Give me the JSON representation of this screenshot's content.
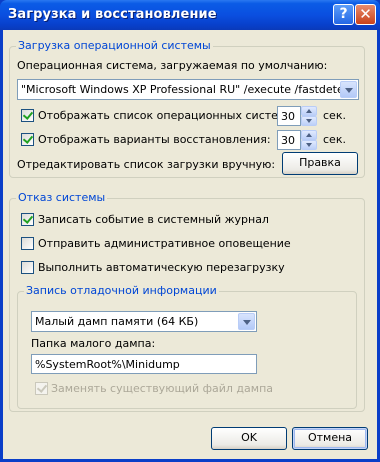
{
  "window": {
    "title": "Загрузка и восстановление",
    "help_icon": "?",
    "close_icon": "✕"
  },
  "boot": {
    "legend": "Загрузка операционной системы",
    "default_os_label": "Операционная система, загружаемая по умолчанию:",
    "default_os_value": "\"Microsoft Windows XP Professional RU\" /execute /fastdetect",
    "show_os_list_label": "Отображать список операционных систем:",
    "show_os_list_checked": true,
    "show_os_list_value": "30",
    "show_recovery_label": "Отображать варианты восстановления:",
    "show_recovery_checked": true,
    "show_recovery_value": "30",
    "seconds_unit": "сек.",
    "edit_label": "Отредактировать список загрузки вручную:",
    "edit_button": "Правка"
  },
  "failure": {
    "legend": "Отказ системы",
    "write_event": "Записать событие в системный журнал",
    "write_event_checked": true,
    "send_alert": "Отправить административное оповещение",
    "send_alert_checked": false,
    "auto_restart": "Выполнить автоматическую перезагрузку",
    "auto_restart_checked": false
  },
  "debug": {
    "legend": "Запись отладочной информации",
    "dump_type": "Малый дамп памяти (64 КБ)",
    "dump_folder_label": "Папка малого дампа:",
    "dump_folder_value": "%SystemRoot%\\Minidump",
    "overwrite_label": "Заменять существующий файл дампа",
    "overwrite_checked": true,
    "overwrite_disabled": true
  },
  "buttons": {
    "ok": "OK",
    "cancel": "Отмена"
  }
}
